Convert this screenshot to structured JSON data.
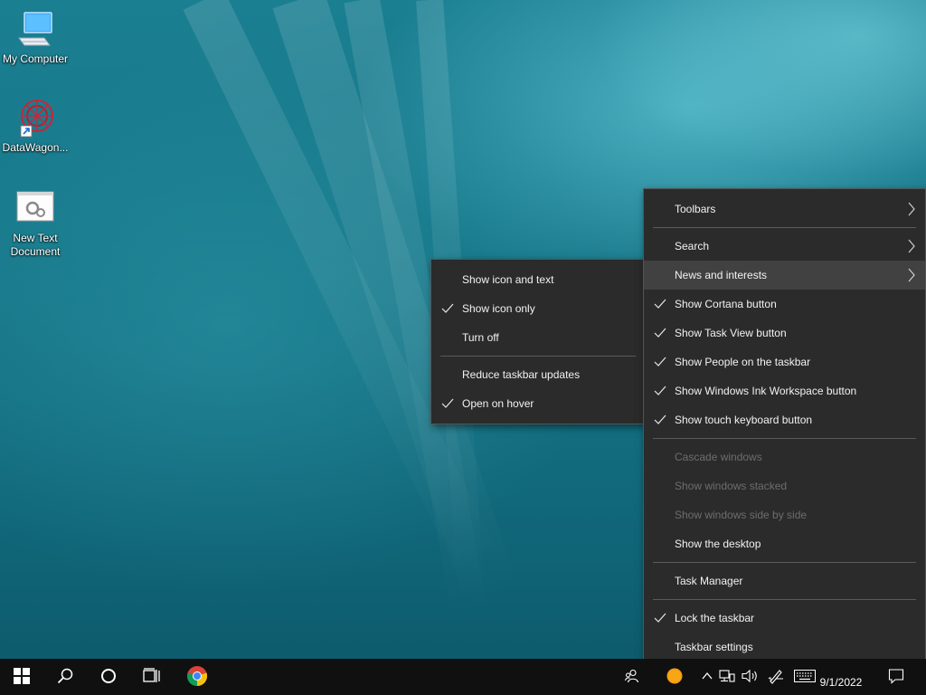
{
  "desktop": {
    "icons": [
      {
        "label": "My Computer",
        "icon": "computer-icon"
      },
      {
        "label": "DataWagon...",
        "icon": "datawagon-app-icon"
      },
      {
        "label": "New Text Document",
        "icon": "text-document-icon"
      }
    ]
  },
  "context_menu": {
    "items": [
      {
        "label": "Toolbars",
        "submenu": true
      },
      {
        "label": "Search",
        "submenu": true
      },
      {
        "label": "News and interests",
        "submenu": true,
        "highlighted": true
      },
      {
        "label": "Show Cortana button",
        "checked": true
      },
      {
        "label": "Show Task View button",
        "checked": true
      },
      {
        "label": "Show People on the taskbar",
        "checked": true
      },
      {
        "label": "Show Windows Ink Workspace button",
        "checked": true
      },
      {
        "label": "Show touch keyboard button",
        "checked": true
      },
      {
        "label": "Cascade windows",
        "disabled": true
      },
      {
        "label": "Show windows stacked",
        "disabled": true
      },
      {
        "label": "Show windows side by side",
        "disabled": true
      },
      {
        "label": "Show the desktop"
      },
      {
        "label": "Task Manager"
      },
      {
        "label": "Lock the taskbar",
        "checked": true
      },
      {
        "label": "Taskbar settings"
      }
    ]
  },
  "submenu_news": {
    "items": [
      {
        "label": "Show icon and text",
        "checked": false
      },
      {
        "label": "Show icon only",
        "checked": true
      },
      {
        "label": "Turn off",
        "checked": false
      },
      {
        "label": "Reduce taskbar updates",
        "checked": false
      },
      {
        "label": "Open on hover",
        "checked": true
      }
    ]
  },
  "taskbar": {
    "buttons": [
      "windows-start-icon",
      "search-icon",
      "cortana-icon",
      "task-view-icon",
      "chrome-icon"
    ],
    "tray_icons": [
      "people-icon",
      "news-weather-icon",
      "chevron-up-icon",
      "network-icon",
      "volume-icon",
      "windows-ink-icon",
      "touch-keyboard-icon",
      "notifications-icon"
    ],
    "date": "9/1/2022"
  },
  "colors": {
    "menu_bg": "#2b2b2b",
    "menu_highlight": "#414141",
    "menu_text": "#f2f2f2",
    "menu_disabled_text": "#6d6d6d",
    "taskbar_bg": "#101010"
  }
}
